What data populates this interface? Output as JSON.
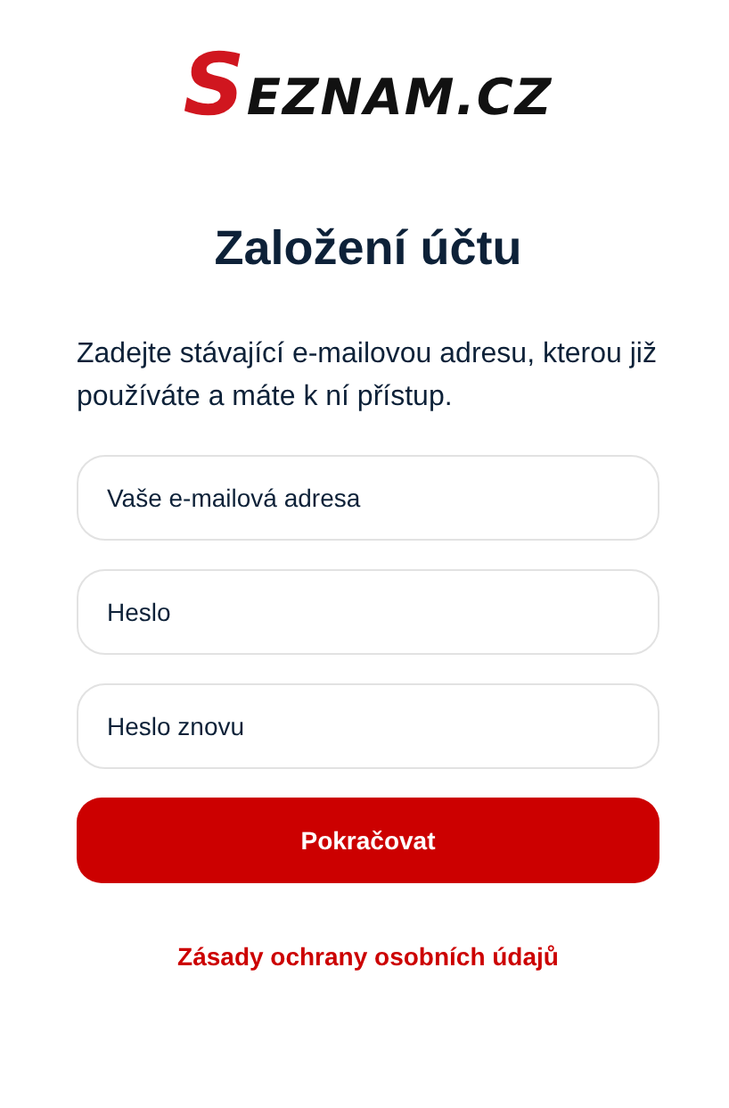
{
  "logo": {
    "initial": "S",
    "rest": "EZNAM.CZ"
  },
  "title": "Založení účtu",
  "description": "Zadejte stávající e-mailovou adresu, kterou již používáte a máte k ní přístup.",
  "fields": [
    {
      "placeholder": "Vaše e-mailová adresa"
    },
    {
      "placeholder": "Heslo"
    },
    {
      "placeholder": "Heslo znovu"
    }
  ],
  "submit_button": "Pokračovat",
  "privacy_link": "Zásady ochrany osobních údajů"
}
